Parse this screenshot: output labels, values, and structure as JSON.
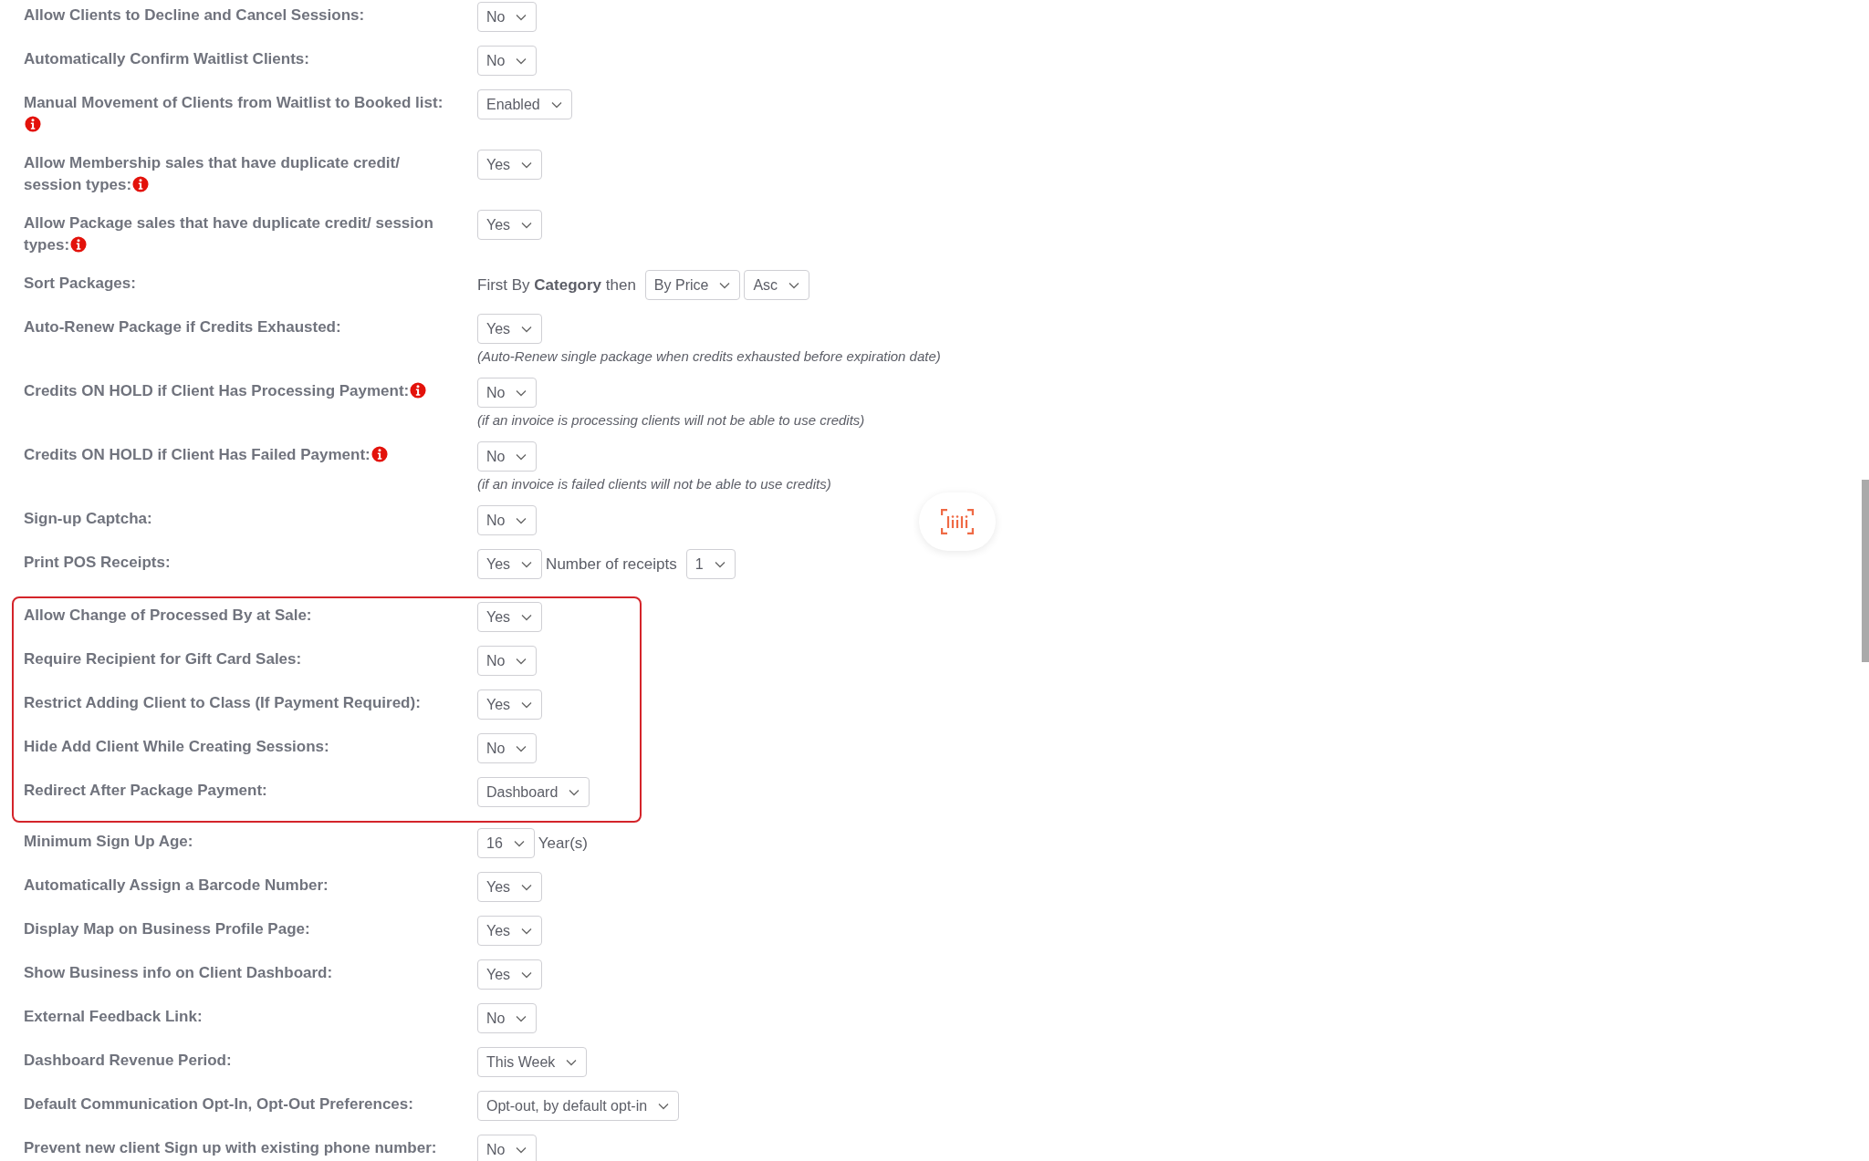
{
  "groups": [
    {
      "highlighted": false,
      "rows": [
        {
          "label": "Allow Clients to Decline and Cancel Sessions:",
          "info": false,
          "controls": [
            {
              "kind": "select",
              "value": "No"
            }
          ]
        },
        {
          "label": "Automatically Confirm Waitlist Clients:",
          "info": false,
          "controls": [
            {
              "kind": "select",
              "value": "No"
            }
          ]
        },
        {
          "label": "Manual Movement of Clients from Waitlist to Booked list:",
          "info": true,
          "controls": [
            {
              "kind": "select",
              "value": "Enabled"
            }
          ]
        },
        {
          "label": "Allow Membership sales that have duplicate credit/ session types:",
          "info": true,
          "controls": [
            {
              "kind": "select",
              "value": "Yes"
            }
          ]
        },
        {
          "label": "Allow Package sales that have duplicate credit/ session types:",
          "info": true,
          "controls": [
            {
              "kind": "select",
              "value": "Yes"
            }
          ]
        },
        {
          "label": "Sort Packages:",
          "info": false,
          "controls": [
            {
              "kind": "text",
              "text": "First By **Category** then"
            },
            {
              "kind": "select",
              "value": "By Price"
            },
            {
              "kind": "select",
              "value": "Asc"
            }
          ]
        },
        {
          "label": "Auto-Renew Package if Credits Exhausted:",
          "info": false,
          "controls": [
            {
              "kind": "select",
              "value": "Yes"
            }
          ],
          "note": "(Auto-Renew single package when credits exhausted before expiration date)"
        },
        {
          "label": "Credits ON HOLD if Client Has Processing Payment:",
          "info": true,
          "controls": [
            {
              "kind": "select",
              "value": "No"
            }
          ],
          "note": "(if an invoice is processing clients will not be able to use credits)"
        },
        {
          "label": "Credits ON HOLD if Client Has Failed Payment:",
          "info": true,
          "controls": [
            {
              "kind": "select",
              "value": "No"
            }
          ],
          "note": "(if an invoice is failed clients will not be able to use credits)"
        },
        {
          "label": "Sign-up Captcha:",
          "info": false,
          "controls": [
            {
              "kind": "select",
              "value": "No"
            }
          ]
        },
        {
          "label": "Print POS Receipts:",
          "info": false,
          "controls": [
            {
              "kind": "select",
              "value": "Yes"
            },
            {
              "kind": "text",
              "text": "Number of receipts"
            },
            {
              "kind": "select",
              "value": "1"
            }
          ]
        }
      ]
    },
    {
      "highlighted": true,
      "rows": [
        {
          "label": "Allow Change of Processed By at Sale:",
          "info": false,
          "controls": [
            {
              "kind": "select",
              "value": "Yes"
            }
          ]
        },
        {
          "label": "Require Recipient for Gift Card Sales:",
          "info": false,
          "controls": [
            {
              "kind": "select",
              "value": "No"
            }
          ]
        },
        {
          "label": "Restrict Adding Client to Class (If Payment Required):",
          "info": false,
          "controls": [
            {
              "kind": "select",
              "value": "Yes"
            }
          ]
        },
        {
          "label": "Hide Add Client While Creating Sessions:",
          "info": false,
          "controls": [
            {
              "kind": "select",
              "value": "No"
            }
          ]
        },
        {
          "label": "Redirect After Package Payment:",
          "info": false,
          "controls": [
            {
              "kind": "select",
              "value": "Dashboard"
            }
          ]
        }
      ]
    },
    {
      "highlighted": false,
      "rows": [
        {
          "label": "Minimum Sign Up Age:",
          "info": false,
          "controls": [
            {
              "kind": "select",
              "value": "16"
            },
            {
              "kind": "text",
              "text": "Year(s)"
            }
          ]
        },
        {
          "label": "Automatically Assign a Barcode Number:",
          "info": false,
          "controls": [
            {
              "kind": "select",
              "value": "Yes"
            }
          ]
        },
        {
          "label": "Display Map on Business Profile Page:",
          "info": false,
          "controls": [
            {
              "kind": "select",
              "value": "Yes"
            }
          ]
        },
        {
          "label": "Show Business info on Client Dashboard:",
          "info": false,
          "controls": [
            {
              "kind": "select",
              "value": "Yes"
            }
          ]
        },
        {
          "label": "External Feedback Link:",
          "info": false,
          "controls": [
            {
              "kind": "select",
              "value": "No"
            }
          ]
        },
        {
          "label": "Dashboard Revenue Period:",
          "info": false,
          "controls": [
            {
              "kind": "select",
              "value": "This Week"
            }
          ]
        },
        {
          "label": "Default Communication Opt-In, Opt-Out Preferences:",
          "info": false,
          "controls": [
            {
              "kind": "select",
              "value": "Opt-out, by default opt-in"
            }
          ]
        },
        {
          "label": "Prevent new client Sign up with existing phone number:",
          "info": false,
          "controls": [
            {
              "kind": "select",
              "value": "No"
            }
          ]
        }
      ]
    }
  ]
}
